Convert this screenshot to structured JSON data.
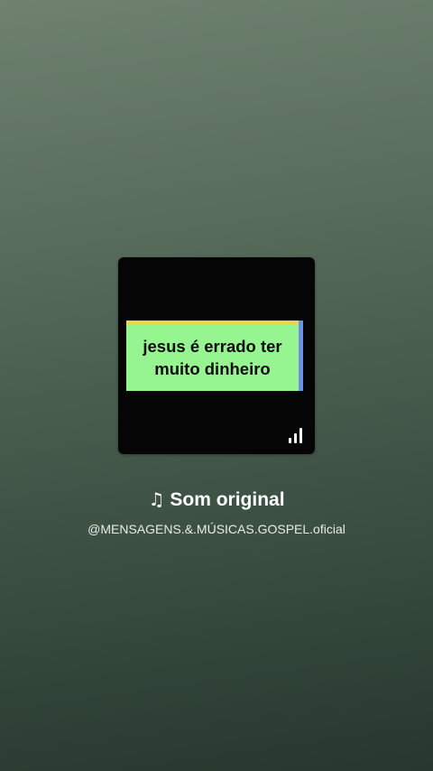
{
  "cover": {
    "text_line1": "jesus é errado ter",
    "text_line2": "muito dinheiro",
    "icon": "signal-bars-icon"
  },
  "sound": {
    "icon": "music-note-icon",
    "title": "Som original",
    "author": "@MENSAGENS.&.MÚSICAS.GOSPEL.oficial"
  },
  "colors": {
    "text_block_front": "#96f590",
    "text_block_top": "#e7d84a",
    "text_block_side": "#6c8fe8"
  }
}
